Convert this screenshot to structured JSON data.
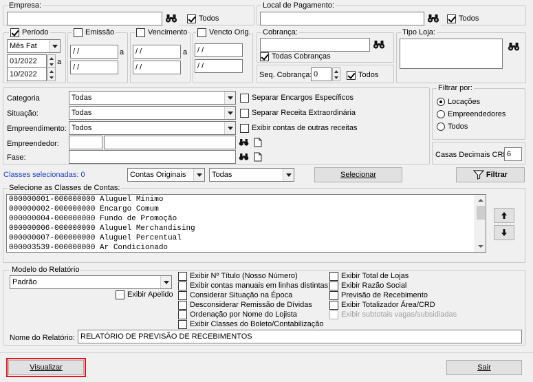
{
  "empresa": {
    "legend": "Empresa:",
    "value": "",
    "todos_label": "Todos",
    "todos_checked": true
  },
  "local_pagamento": {
    "legend": "Local de Pagamento:",
    "value": "",
    "todos_label": "Todos",
    "todos_checked": true
  },
  "periodo": {
    "legend": "Período",
    "checked": true,
    "type_value": "Mês Fat",
    "from": "01/2022",
    "to": "10/2022",
    "a_label": "a"
  },
  "emissao": {
    "legend": "Emissão",
    "checked": false,
    "from": " / /",
    "to": " / /",
    "a_label": "a"
  },
  "vencimento": {
    "legend": "Vencimento",
    "checked": false,
    "from": " / /",
    "to": " / /",
    "a_label": "a"
  },
  "vencto_orig": {
    "legend": "Vencto Orig.",
    "checked": false,
    "from": " / /",
    "to": " / /"
  },
  "cobranca": {
    "legend": "Cobrança:",
    "value": "",
    "todas_label": "Todas Cobranças",
    "todas_checked": true,
    "seq_label": "Seq. Cobrança:",
    "seq_value": "0",
    "todos_label": "Todos",
    "todos_checked": true
  },
  "tipo_loja": {
    "legend": "Tipo Loja:",
    "value": ""
  },
  "filters": {
    "categoria_label": "Categoria",
    "categoria_value": "Todas",
    "situacao_label": "Situação:",
    "situacao_value": "Todas",
    "empreendimento_label": "Empreendimento:",
    "empreendimento_value": "Todos",
    "empreendedor_label": "Empreendedor:",
    "empreendedor_code": "",
    "empreendedor_name": "",
    "fase_label": "Fase:",
    "fase_value": "",
    "separar_encargos": "Separar Encargos Específicos",
    "separar_receita": "Separar Receita Extraordinária",
    "exibir_contas": "Exibir contas de outras receitas"
  },
  "filtrar_por": {
    "legend": "Filtrar por:",
    "options": [
      "Locações",
      "Empreendedores",
      "Todos"
    ],
    "selected": 0
  },
  "casas_decimais": {
    "label": "Casas Decimais CRD",
    "value": "6"
  },
  "classes": {
    "selected_label": "Classes selecionadas: 0",
    "contas_value": "Contas Originais",
    "todas_value": "Todas",
    "selecionar_label": "Selecionar",
    "filtrar_label": "Filtrar",
    "legend": "Selecione as Classes de Contas:",
    "items": [
      "000000001-000000000 Aluguel Mínimo",
      "000000002-000000000 Encargo Comum",
      "000000004-000000000 Fundo de Promoção",
      "000000006-000000000 Aluguel Merchandising",
      "000000007-000000000 Aluguel Percentual",
      "000003539-000000000 Ar Condicionado"
    ]
  },
  "modelo": {
    "legend": "Modelo do Relatório",
    "value": "Padrão",
    "exibir_apelido": "Exibir Apelido",
    "options_col1": [
      "Exibir Nº Título (Nosso Número)",
      "Exibir contas manuais em linhas distintas",
      "Considerar Situação na Época",
      "Desconsiderar Remissão de Dívidas",
      "Ordenação por Nome do Lojista",
      "Exibir Classes do Boleto/Contabilização"
    ],
    "options_col2": [
      "Exibir Total de Lojas",
      "Exibir Razão Social",
      "Previsão de Recebimento",
      "Exibir Totalizador Área/CRD",
      "Exibir subtotais vagas/subsidiadas"
    ],
    "nome_label": "Nome do Relatório:",
    "nome_value": "RELATÓRIO DE PREVISÃO DE RECEBIMENTOS"
  },
  "footer": {
    "visualizar_label": "Visualizar",
    "sair_label": "Sair"
  },
  "colors": {
    "highlight_red": "#e8141b",
    "link_blue": "#1f3fbf"
  }
}
